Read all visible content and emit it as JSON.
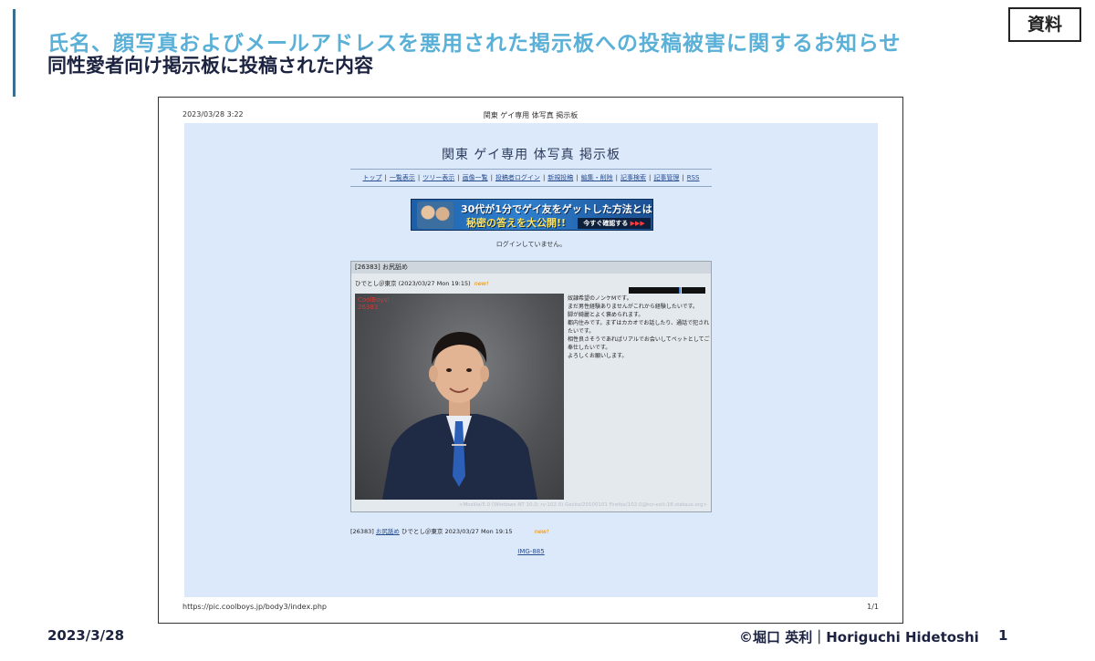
{
  "slide": {
    "title": "氏名、顔写真およびメールアドレスを悪用された掲示板への投稿被害に関するお知らせ",
    "subtitle": "同性愛者向け掲示板に投稿された内容",
    "badge": "資料",
    "date": "2023/3/28",
    "copyright": "©堀口 英利｜Horiguchi Hidetoshi",
    "page_number": "1",
    "accent_color": "#5ab0d6"
  },
  "printout": {
    "print_datetime": "2023/03/28 3:22",
    "page_title": "関東 ゲイ専用 体写真 掲示板",
    "url": "https://pic.coolboys.jp/body3/index.php",
    "page_count": "1/1"
  },
  "site": {
    "title": "関東 ゲイ専用 体写真 掲示板",
    "nav": [
      "トップ",
      "一覧表示",
      "ツリー表示",
      "画像一覧",
      "投稿者ログイン",
      "新規投稿",
      "編集・削除",
      "記事検索",
      "記事管理",
      "RSS"
    ],
    "banner": {
      "line1": "30代が1分でゲイ友をゲットした方法とは?!",
      "line2": "秘密の答えを大公開!!",
      "cta": "今すぐ確認する",
      "cta_arrows": "▶▶▶"
    },
    "login_status": "ログインしていません。",
    "post": {
      "header": "[26383]  お尻舐め",
      "author_line": "ひでとし＠東京  (2023/03/27 Mon 19:15)",
      "new_label": "new!",
      "photo_watermark": "CoolBoys!\n26383",
      "body": [
        "奴隷希望のノンケMです。",
        "まだ男性経験ありませんがこれから経験したいです。",
        "脚が綺麗とよく褒められます。",
        "都内住みです。まずはカカオでお話したり、通話で犯されたいです。",
        "相性良さそうであればリアルでお会いしてペットとしてご奉仕したいです。",
        "よろしくお願いします。"
      ],
      "user_agent": "<Mozilla/5.0 (Windows NT 10.0; rv:102.0) Gecko/20100101 Firefox/102.0@tor-exit-18.stataus.org>"
    },
    "list_entry": {
      "id": "[26383]",
      "subject": "お尻舐め",
      "author_date": "ひでとし＠東京  2023/03/27 Mon 19:15",
      "new_label": "new!"
    },
    "image_link": "IMG-885"
  }
}
